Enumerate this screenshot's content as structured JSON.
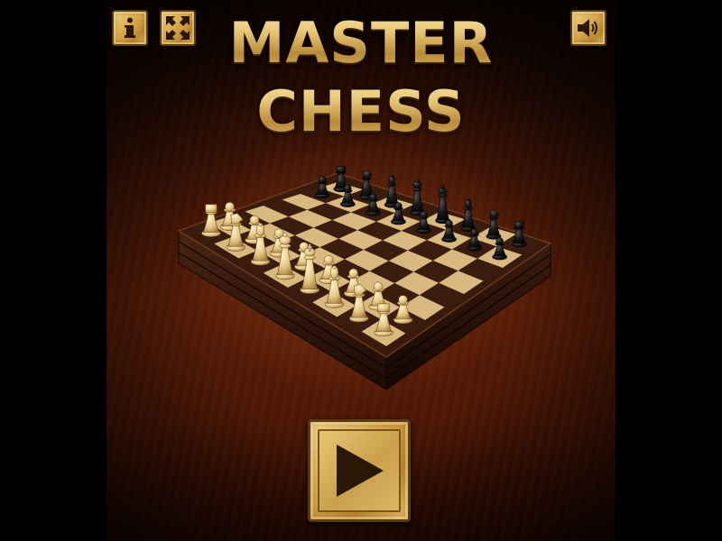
{
  "title": {
    "line1": "MASTER",
    "line2": "CHESS"
  },
  "toolbar": {
    "info_icon": "info-icon",
    "fullscreen_icon": "fullscreen-icon",
    "sound_icon": "speaker-icon"
  },
  "play": {
    "icon": "play-icon"
  },
  "board": {
    "files": 8,
    "ranks": 8,
    "white_pieces": [
      "rook",
      "knight",
      "bishop",
      "queen",
      "king",
      "bishop",
      "knight",
      "rook",
      "pawn",
      "pawn",
      "pawn",
      "pawn",
      "pawn",
      "pawn",
      "pawn",
      "pawn"
    ],
    "black_pieces": [
      "rook",
      "knight",
      "bishop",
      "queen",
      "king",
      "bishop",
      "knight",
      "rook",
      "pawn",
      "pawn",
      "pawn",
      "pawn",
      "pawn",
      "pawn",
      "pawn",
      "pawn"
    ]
  },
  "colors": {
    "gold": "#d9a94c",
    "gold_light": "#f3d58b",
    "board_frame": "#3a1a0c",
    "light_square": "#d9b980",
    "dark_square": "#3b1d10",
    "white_piece": "#e8cf92",
    "black_piece": "#141414"
  }
}
